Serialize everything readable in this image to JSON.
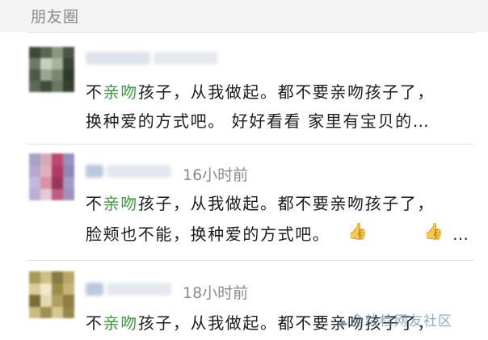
{
  "header": {
    "title": "朋友圈"
  },
  "posts": [
    {
      "time": "",
      "highlight_before": "不",
      "highlight_word": "亲吻",
      "line1_rest": "孩子，从我做起。都不要亲吻孩子了，",
      "line2": "换种爱的方式吧。 好好看看  家里有宝贝的…"
    },
    {
      "time": "16小时前",
      "highlight_before": "不",
      "highlight_word": "亲吻",
      "line1_rest": "孩子，从我做起。都不要亲吻孩子了，",
      "line2": "脸颊也不能，换种爱的方式吧。",
      "thumb_icon": "thumbs-up-icon",
      "more": "…"
    },
    {
      "time": "18小时前",
      "highlight_before": "不",
      "highlight_word": "亲吻",
      "line1_rest": "孩子，从我做起。都不要亲吻孩子了，"
    }
  ],
  "watermark": {
    "icon": "wechat-icon",
    "text": "全线检网友社区"
  },
  "colors": {
    "highlight": "#3a9b3a",
    "header_bg": "#f3f3f3",
    "muted": "#8a8a8a"
  }
}
